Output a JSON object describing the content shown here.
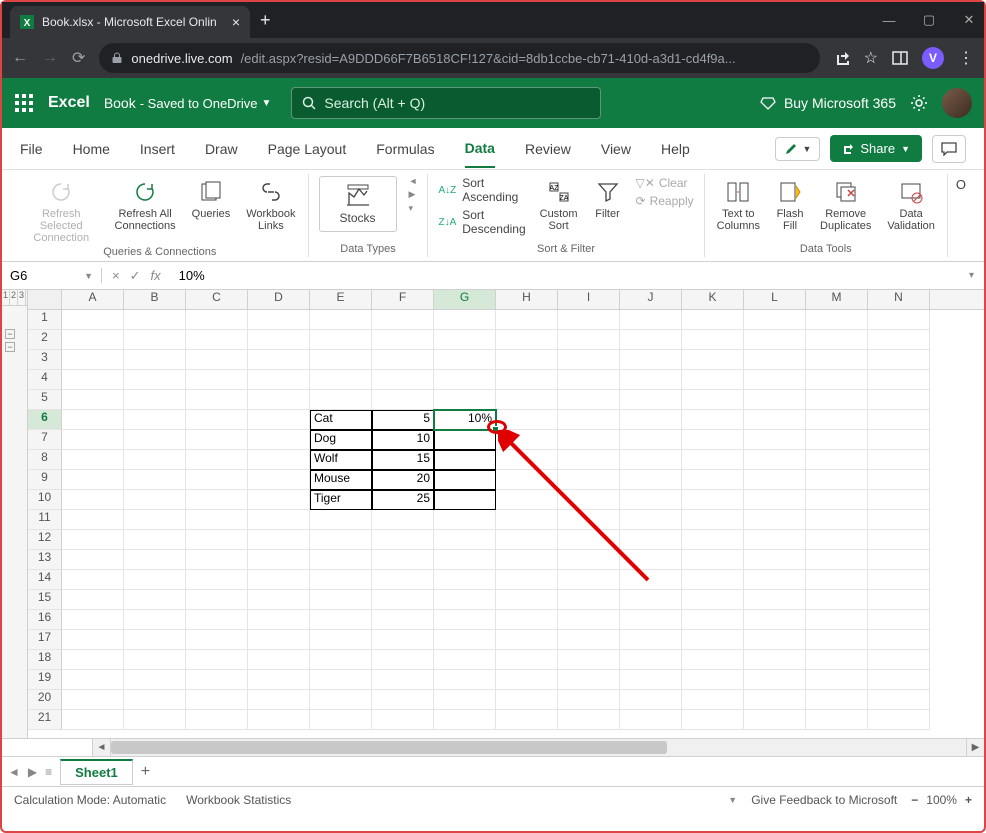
{
  "browser": {
    "tab_title": "Book.xlsx - Microsoft Excel Onlin",
    "url_domain": "onedrive.live.com",
    "url_path": "/edit.aspx?resid=A9DDD66F7B6518CF!127&cid=8db1ccbe-cb71-410d-a3d1-cd4f9a...",
    "avatar_letter": "V"
  },
  "header": {
    "brand": "Excel",
    "doc_name": "Book",
    "saved_label": "- Saved to OneDrive",
    "search_placeholder": "Search (Alt + Q)",
    "buy_label": "Buy Microsoft 365"
  },
  "ribbon_tabs": [
    "File",
    "Home",
    "Insert",
    "Draw",
    "Page Layout",
    "Formulas",
    "Data",
    "Review",
    "View",
    "Help"
  ],
  "ribbon_active": "Data",
  "share_label": "Share",
  "ribbon": {
    "refresh_selected": "Refresh Selected Connection",
    "refresh_all": "Refresh All Connections",
    "queries": "Queries",
    "workbook_links": "Workbook Links",
    "group_queries": "Queries & Connections",
    "stocks": "Stocks",
    "group_types": "Data Types",
    "sort_asc": "Sort Ascending",
    "sort_desc": "Sort Descending",
    "custom_sort": "Custom Sort",
    "filter": "Filter",
    "clear": "Clear",
    "reapply": "Reapply",
    "group_sort": "Sort & Filter",
    "text_to_columns": "Text to Columns",
    "flash_fill": "Flash Fill",
    "remove_dup": "Remove Duplicates",
    "data_validation": "Data Validation",
    "group_tools": "Data Tools",
    "outline_letter": "O"
  },
  "name_box": "G6",
  "fx_label": "fx",
  "formula_value": "10%",
  "columns": [
    "A",
    "B",
    "C",
    "D",
    "E",
    "F",
    "G",
    "H",
    "I",
    "J",
    "K",
    "L",
    "M",
    "N"
  ],
  "active_col": "G",
  "active_row": 6,
  "row_count": 21,
  "outline_levels": [
    "1",
    "2",
    "3"
  ],
  "table": {
    "rows": [
      {
        "r": 6,
        "e": "Cat",
        "f": "5",
        "g": "10%"
      },
      {
        "r": 7,
        "e": "Dog",
        "f": "10",
        "g": ""
      },
      {
        "r": 8,
        "e": "Wolf",
        "f": "15",
        "g": ""
      },
      {
        "r": 9,
        "e": "Mouse",
        "f": "20",
        "g": ""
      },
      {
        "r": 10,
        "e": "Tiger",
        "f": "25",
        "g": ""
      }
    ]
  },
  "sheet_tab": "Sheet1",
  "status": {
    "calc_mode": "Calculation Mode: Automatic",
    "wb_stats": "Workbook Statistics",
    "feedback": "Give Feedback to Microsoft",
    "zoom": "100%"
  }
}
